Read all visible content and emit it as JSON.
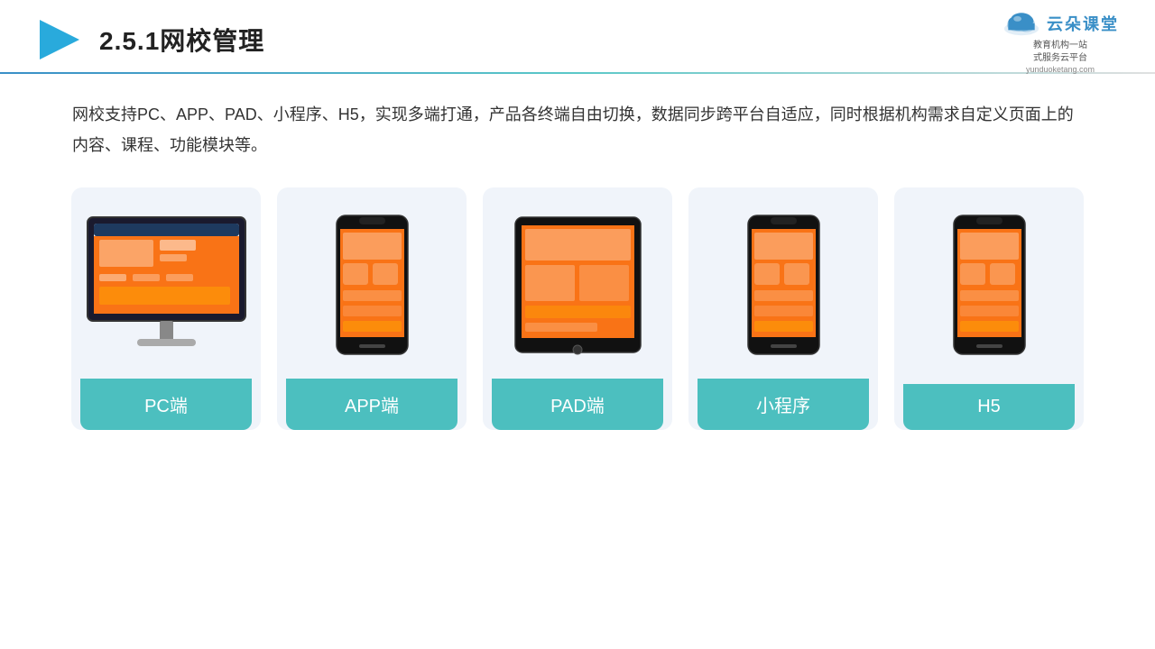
{
  "header": {
    "title": "2.5.1网校管理",
    "brand": {
      "name": "云朵课堂",
      "url": "yunduoketang.com",
      "tagline": "教育机构一站\n式服务云平台"
    }
  },
  "body": {
    "description": "网校支持PC、APP、PAD、小程序、H5，实现多端打通，产品各终端自由切换，数据同步跨平台自适应，同时根据机构需求自定义页面上的内容、课程、功能模块等。"
  },
  "cards": [
    {
      "id": "pc",
      "label": "PC端",
      "type": "pc"
    },
    {
      "id": "app",
      "label": "APP端",
      "type": "phone"
    },
    {
      "id": "pad",
      "label": "PAD端",
      "type": "tablet"
    },
    {
      "id": "miniapp",
      "label": "小程序",
      "type": "phone"
    },
    {
      "id": "h5",
      "label": "H5",
      "type": "phone"
    }
  ],
  "colors": {
    "accent": "#4cbfbf",
    "title": "#222222",
    "text": "#333333",
    "brand_blue": "#3a8fc7",
    "card_bg": "#f0f4fa"
  }
}
